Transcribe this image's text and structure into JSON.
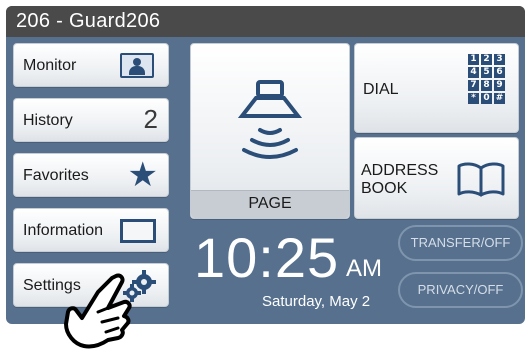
{
  "title": "206 - Guard206",
  "left_menu": {
    "monitor_label": "Monitor",
    "history_label": "History",
    "history_count": "2",
    "favorites_label": "Favorites",
    "information_label": "Information",
    "settings_label": "Settings"
  },
  "main": {
    "page_label": "PAGE",
    "dial_label": "DIAL",
    "address_book_label": "ADDRESS BOOK",
    "keypad_keys": [
      "1",
      "2",
      "3",
      "4",
      "5",
      "6",
      "7",
      "8",
      "9",
      "*",
      "0",
      "#"
    ]
  },
  "clock": {
    "time": "10:25",
    "ampm": "AM",
    "date": "Saturday, May 2"
  },
  "status": {
    "transfer": "TRANSFER/OFF",
    "privacy": "PRIVACY/OFF"
  },
  "icons": [
    "monitor-icon",
    "star-icon",
    "information-icon",
    "gear-icon",
    "speaker-icon",
    "keypad-icon",
    "book-icon",
    "pointing-hand-icon"
  ],
  "colors": {
    "screen": "#56708e",
    "titlebar": "#4a4a4a",
    "icon_blue": "#2b4e78"
  }
}
